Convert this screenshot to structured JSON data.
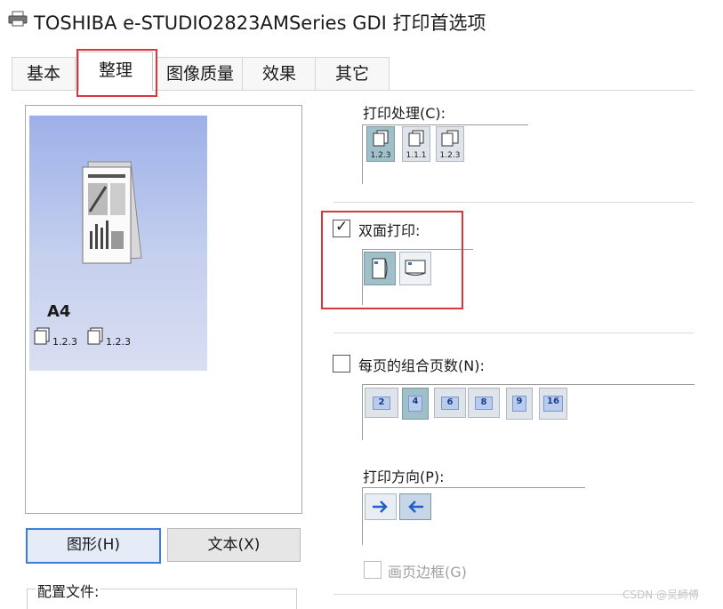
{
  "window": {
    "title": "TOSHIBA e-STUDIO2823AMSeries GDI 打印首选项",
    "icon": "printer-icon"
  },
  "tabs": [
    {
      "label": "基本",
      "active": false
    },
    {
      "label": "整理",
      "active": true
    },
    {
      "label": "图像质量",
      "active": false
    },
    {
      "label": "效果",
      "active": false
    },
    {
      "label": "其它",
      "active": false
    }
  ],
  "preview": {
    "paper_size": "A4",
    "stacks": [
      "1.2.3",
      "1.2.3"
    ]
  },
  "preview_buttons": {
    "graphic": "图形(H)",
    "text": "文本(X)"
  },
  "profile": {
    "label": "配置文件:"
  },
  "print_process": {
    "label": "打印处理(C):",
    "options": [
      "1.2.3",
      "1.1.1",
      "1.2.3"
    ]
  },
  "duplex": {
    "label": "双面打印:",
    "checked": true,
    "options": [
      "long-edge-flip-icon",
      "short-edge-flip-icon"
    ],
    "selected_index": 0
  },
  "nup": {
    "label": "每页的组合页数(N):",
    "checked": false,
    "options": [
      "2",
      "4",
      "6",
      "8",
      "9",
      "16"
    ],
    "selected_index": 1
  },
  "direction": {
    "label": "打印方向(P):",
    "options": [
      "right-arrow-icon",
      "left-arrow-icon"
    ]
  },
  "page_border": {
    "label": "画页边框(G)",
    "checked": false,
    "enabled": false
  },
  "watermark": "CSDN @吴師傅",
  "colors": {
    "highlight_red": "#d9363e",
    "selected_icon": "#9fc0c8",
    "preview_blue": "#9db0e8"
  }
}
